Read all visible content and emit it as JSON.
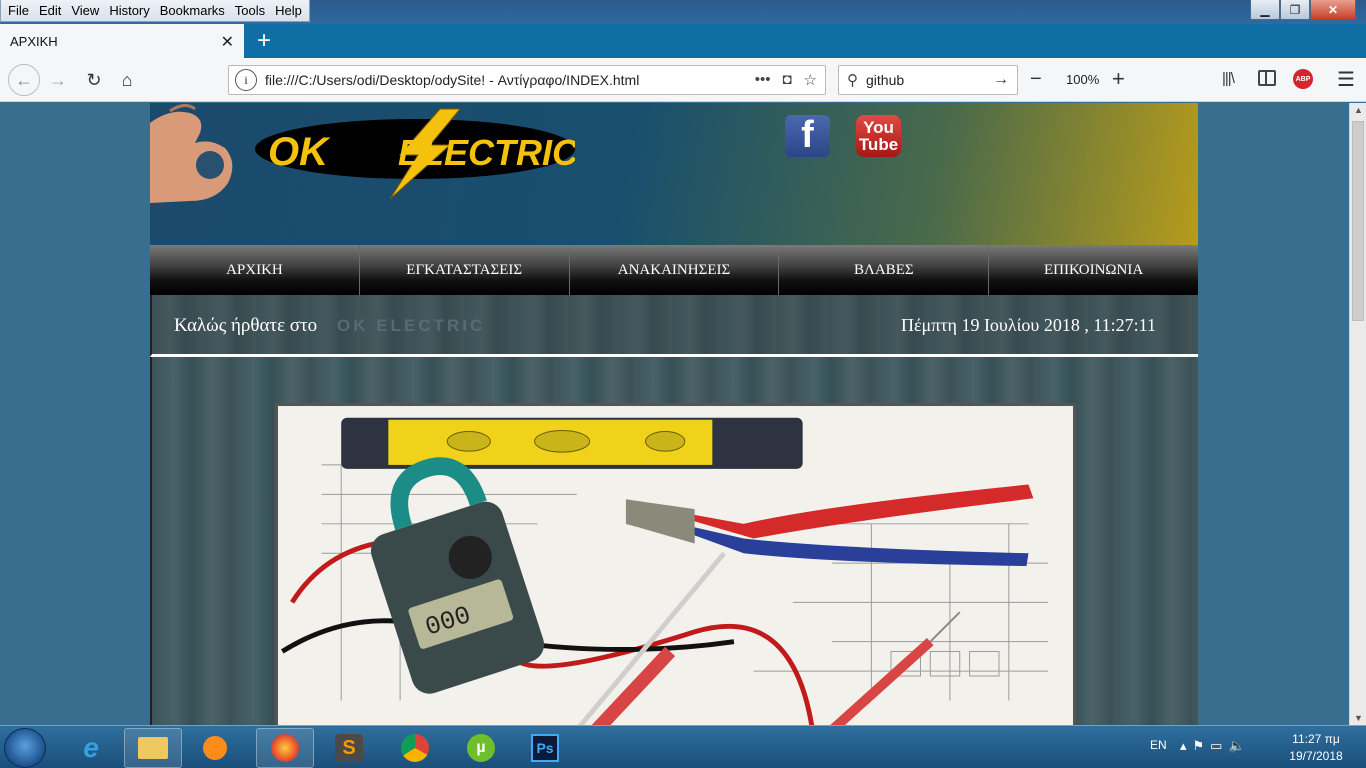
{
  "browser": {
    "menu": [
      "File",
      "Edit",
      "View",
      "History",
      "Bookmarks",
      "Tools",
      "Help"
    ],
    "tab_title": "ΑΡΧΙΚΗ",
    "url": "file:///C:/Users/odi/Desktop/odySite! - Αντίγραφο/INDEX.html",
    "search_value": "github",
    "zoom": "100%"
  },
  "site": {
    "logo_text_left": "OK",
    "logo_text_right": "ELECTRIC",
    "youtube_top": "You",
    "youtube_bottom": "Tube",
    "facebook_letter": "f",
    "nav": [
      "ΑΡΧΙΚΗ",
      "ΕΓΚΑΤΑΣΤΑΣΕΙΣ",
      "ΑΝΑΚΑΙΝΗΣΕΙΣ",
      "ΒΛΑΒΕΣ",
      "ΕΠΙΚΟΙΝΩΝΙΑ"
    ],
    "welcome": "Καλώς ήρθατε στο",
    "welcome_brand": "OK ELECTRIC",
    "datetime": "Πέμπτη 19 Ιουλίου 2018 , 11:27:11"
  },
  "taskbar": {
    "language": "EN",
    "time": "11:27 πμ",
    "date": "19/7/2018"
  },
  "colors": {
    "accent_blue": "#0f6fa5",
    "logo_yellow": "#f4c20d"
  }
}
